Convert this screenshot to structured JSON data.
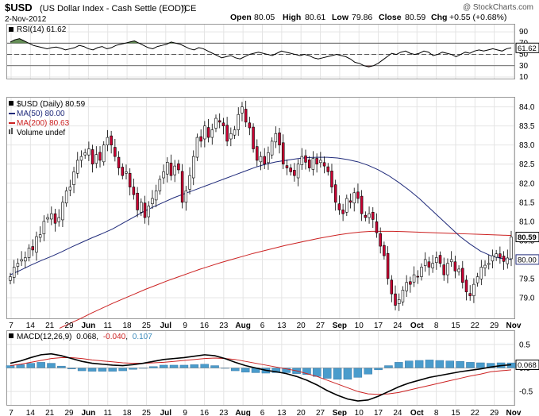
{
  "header": {
    "symbol": "$USD",
    "description": "(US Dollar Index - Cash Settle (EOD))",
    "exchange": "ICE",
    "watermark": "@ StockCharts.com",
    "date": "2-Nov-2012",
    "quote": {
      "open_label": "Open",
      "open": "80.05",
      "high_label": "High",
      "high": "80.61",
      "low_label": "Low",
      "low": "79.86",
      "close_label": "Close",
      "close": "80.59",
      "chg_label": "Chg",
      "chg": "+0.55 (+0.68%)"
    }
  },
  "colors": {
    "price_line": "#000000",
    "up_candle": "#ffffff",
    "down_candle": "#cc0033",
    "ma50": "#1f2a7a",
    "ma200": "#cc2222",
    "rsi_fill_over": "#4a7a3a",
    "rsi_fill_under": "#8a4444",
    "macd_line": "#000000",
    "macd_signal": "#cc2222",
    "macd_hist": "#4a9ccc",
    "grid": "#e4e4e4"
  },
  "chart_data": [
    {
      "type": "line",
      "panel": "rsi",
      "legend": "RSI(14) 61.62",
      "ylim": [
        10,
        100
      ],
      "ticks": [
        "90",
        "70",
        "50",
        "30",
        "10"
      ],
      "tick_values": [
        90,
        70,
        50,
        30,
        10
      ],
      "reference_lines": [
        70,
        50,
        30
      ],
      "last_value": "61.62",
      "values": [
        72,
        76,
        78,
        74,
        70,
        66,
        64,
        62,
        60,
        62,
        63,
        61,
        58,
        60,
        62,
        66,
        64,
        60,
        58,
        62,
        64,
        60,
        62,
        66,
        68,
        70,
        72,
        74,
        70,
        66,
        62,
        60,
        64,
        66,
        68,
        72,
        70,
        68,
        64,
        60,
        58,
        62,
        60,
        56,
        52,
        48,
        44,
        46,
        48,
        44,
        42,
        46,
        50,
        52,
        54,
        52,
        50,
        48,
        52,
        56,
        54,
        52,
        50,
        48,
        50,
        48,
        44,
        42,
        44,
        46,
        48,
        50,
        48,
        46,
        42,
        36,
        34,
        30,
        28,
        30,
        34,
        40,
        46,
        52,
        50,
        54,
        56,
        52,
        50,
        52,
        56,
        54,
        48,
        50,
        54,
        52,
        50,
        46,
        50,
        54,
        52,
        56,
        58,
        56,
        58,
        60,
        58,
        56,
        60,
        61.62
      ]
    },
    {
      "type": "candlestick",
      "panel": "price",
      "legend": [
        "$USD (Daily) 80.59",
        "MA(50) 80.00",
        "MA(200) 80.63",
        "Volume undef"
      ],
      "ylim": [
        78.5,
        84.2
      ],
      "ticks": [
        "84.0",
        "83.5",
        "83.0",
        "82.5",
        "82.0",
        "81.5",
        "81.0",
        "80.5",
        "80.0",
        "79.5",
        "79.0"
      ],
      "tick_values": [
        84.0,
        83.5,
        83.0,
        82.5,
        82.0,
        81.5,
        81.0,
        80.5,
        80.0,
        79.5,
        79.0
      ],
      "last_close_label": "80.59",
      "ma50_label": "80.00",
      "closes": [
        79.55,
        79.8,
        79.9,
        80.0,
        80.05,
        80.3,
        80.25,
        80.6,
        80.65,
        81.0,
        81.1,
        81.2,
        80.95,
        81.1,
        81.5,
        81.8,
        81.9,
        82.3,
        82.6,
        82.7,
        82.8,
        82.9,
        82.5,
        82.75,
        82.6,
        83.0,
        83.2,
        83.0,
        82.7,
        82.4,
        82.2,
        82.3,
        81.9,
        81.7,
        81.3,
        81.5,
        81.1,
        81.4,
        81.6,
        81.8,
        82.1,
        82.3,
        82.55,
        82.2,
        82.45,
        82.35,
        81.5,
        81.8,
        82.2,
        82.7,
        83.2,
        83.1,
        83.5,
        83.2,
        83.4,
        83.7,
        83.6,
        83.5,
        83.1,
        83.3,
        83.4,
        83.8,
        84.0,
        83.6,
        83.45,
        82.9,
        82.6,
        82.7,
        82.5,
        82.8,
        83.1,
        83.3,
        83.0,
        82.5,
        82.4,
        82.3,
        82.2,
        82.5,
        82.7,
        82.55,
        82.4,
        82.65,
        82.5,
        82.6,
        82.45,
        82.3,
        81.9,
        81.5,
        81.3,
        81.2,
        81.6,
        81.5,
        81.75,
        81.6,
        81.2,
        81.1,
        81.2,
        81.05,
        80.7,
        80.35,
        80.1,
        79.5,
        79.1,
        78.8,
        78.95,
        79.2,
        79.4,
        79.35,
        79.6,
        79.55,
        79.8,
        80.0,
        79.8,
        79.9,
        80.05,
        79.9,
        79.6,
        79.9,
        80.0,
        79.7,
        79.75,
        79.4,
        79.15,
        79.05,
        79.35,
        79.55,
        79.8,
        79.85,
        79.9,
        80.1,
        80.15,
        80.05,
        79.95,
        80.04,
        80.59
      ],
      "ma50": [
        79.6,
        79.72,
        79.85,
        79.97,
        80.08,
        80.2,
        80.33,
        80.45,
        80.57,
        80.68,
        80.8,
        80.95,
        81.1,
        81.25,
        81.38,
        81.5,
        81.62,
        81.72,
        81.82,
        81.92,
        82.02,
        82.12,
        82.22,
        82.32,
        82.42,
        82.5,
        82.56,
        82.6,
        82.64,
        82.67,
        82.68,
        82.68,
        82.66,
        82.62,
        82.56,
        82.47,
        82.35,
        82.2,
        82.02,
        81.82,
        81.6,
        81.35,
        81.1,
        80.85,
        80.6,
        80.4,
        80.22,
        80.1,
        80.03,
        80.0
      ],
      "ma200": [
        78.2,
        78.33,
        78.46,
        78.6,
        78.73,
        78.86,
        78.98,
        79.1,
        79.22,
        79.33,
        79.44,
        79.54,
        79.64,
        79.74,
        79.83,
        79.92,
        80.0,
        80.08,
        80.16,
        80.23,
        80.3,
        80.37,
        80.43,
        80.49,
        80.55,
        80.6,
        80.65,
        80.69,
        80.72,
        80.74,
        80.74,
        80.74,
        80.73,
        80.72,
        80.71,
        80.7,
        80.69,
        80.68,
        80.67,
        80.66,
        80.65,
        80.64,
        80.63
      ],
      "x_tick_labels": [
        "7",
        "14",
        "21",
        "29",
        "Jun",
        "11",
        "18",
        "25",
        "Jul",
        "9",
        "16",
        "23",
        "Aug",
        "6",
        "13",
        "20",
        "27",
        "Sep",
        "10",
        "17",
        "24",
        "Oct",
        "8",
        "15",
        "22",
        "29",
        "Nov"
      ]
    },
    {
      "type": "line",
      "panel": "macd",
      "legend_name": "MACD(12,26,9)",
      "legend_values": [
        "0.068",
        "-0.040",
        "0.107"
      ],
      "ylim": [
        -0.75,
        0.75
      ],
      "ticks": [
        "0.5",
        "0.0",
        "-0.5"
      ],
      "tick_values": [
        0.5,
        0.0,
        -0.5
      ],
      "last_value": "0.068",
      "macd": [
        0.1,
        0.15,
        0.22,
        0.28,
        0.3,
        0.26,
        0.2,
        0.14,
        0.1,
        0.08,
        0.06,
        0.05,
        0.07,
        0.1,
        0.14,
        0.18,
        0.2,
        0.22,
        0.25,
        0.28,
        0.26,
        0.2,
        0.12,
        0.05,
        0.0,
        -0.05,
        -0.08,
        -0.12,
        -0.18,
        -0.26,
        -0.36,
        -0.48,
        -0.58,
        -0.66,
        -0.7,
        -0.68,
        -0.6,
        -0.5,
        -0.4,
        -0.32,
        -0.26,
        -0.2,
        -0.16,
        -0.12,
        -0.08,
        -0.05,
        -0.02,
        0.02,
        0.05,
        0.068
      ],
      "signal": [
        0.05,
        0.08,
        0.12,
        0.16,
        0.2,
        0.22,
        0.22,
        0.2,
        0.17,
        0.15,
        0.13,
        0.11,
        0.1,
        0.1,
        0.11,
        0.12,
        0.14,
        0.16,
        0.18,
        0.2,
        0.21,
        0.2,
        0.18,
        0.14,
        0.1,
        0.06,
        0.02,
        -0.02,
        -0.06,
        -0.12,
        -0.18,
        -0.26,
        -0.34,
        -0.42,
        -0.5,
        -0.55,
        -0.56,
        -0.55,
        -0.52,
        -0.47,
        -0.42,
        -0.37,
        -0.32,
        -0.27,
        -0.22,
        -0.17,
        -0.13,
        -0.08,
        -0.06,
        -0.04
      ],
      "x_tick_labels": [
        "7",
        "14",
        "21",
        "29",
        "Jun",
        "11",
        "18",
        "25",
        "Jul",
        "9",
        "16",
        "23",
        "Aug",
        "6",
        "13",
        "20",
        "27",
        "Sep",
        "10",
        "17",
        "24",
        "Oct",
        "8",
        "15",
        "22",
        "29",
        "Nov"
      ]
    }
  ]
}
